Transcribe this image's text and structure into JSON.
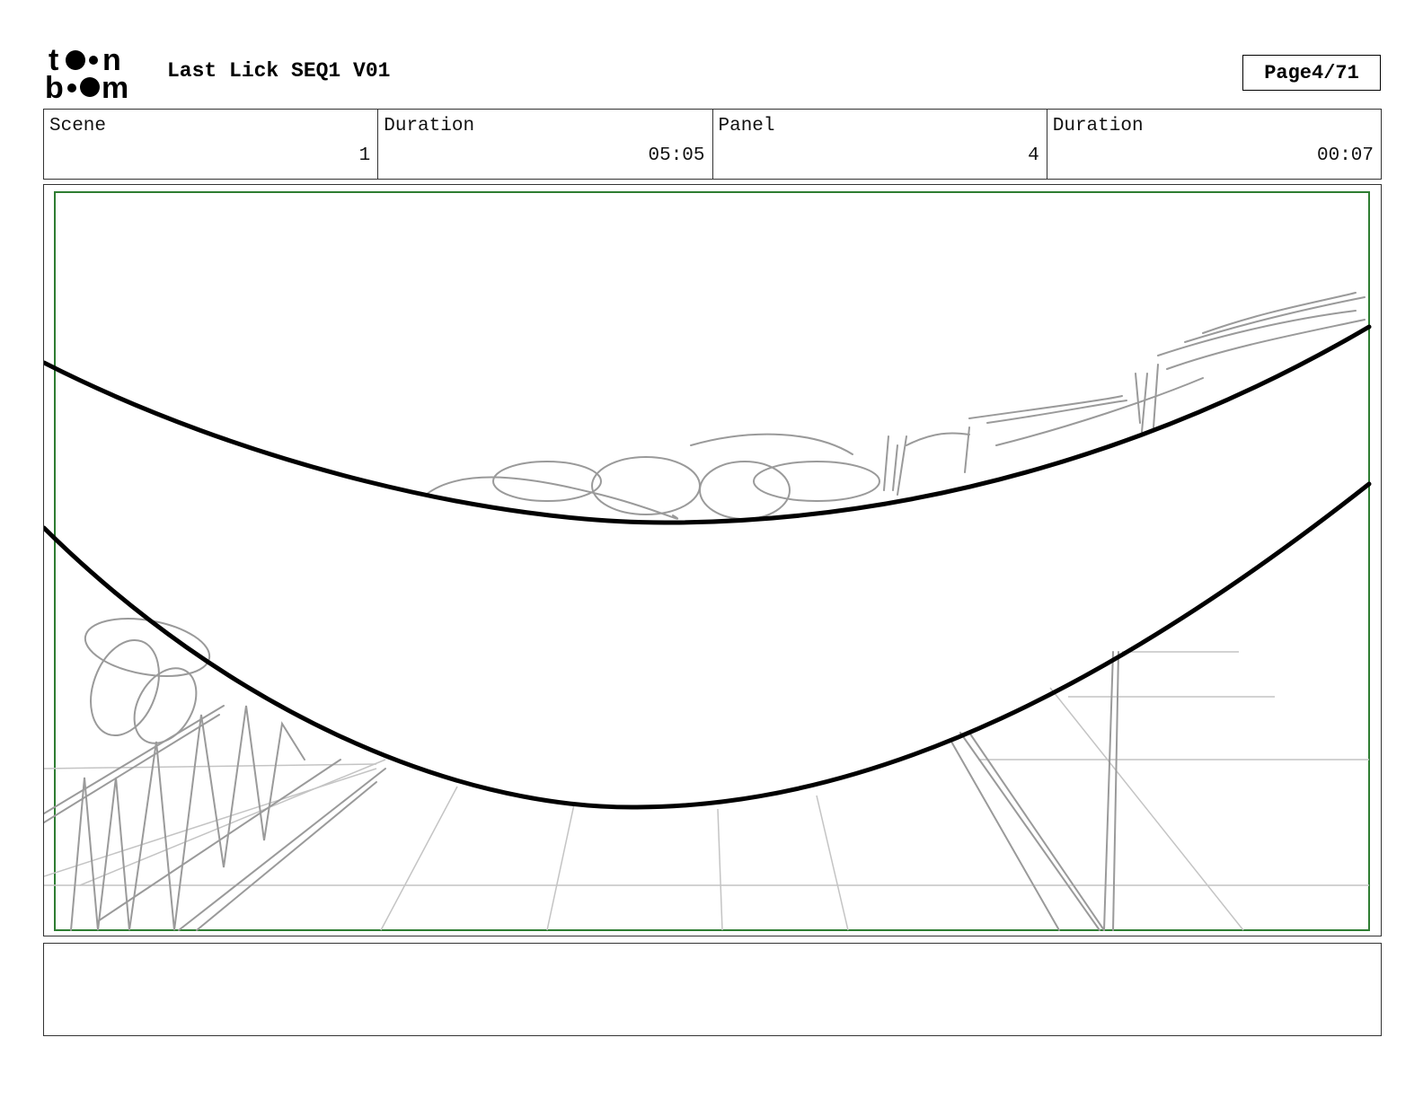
{
  "header": {
    "logo": "toon boom",
    "title": "Last Lick SEQ1 V01",
    "page_label": "Page",
    "page_value": "4/71"
  },
  "info": {
    "scene_label": "Scene",
    "scene_value": "1",
    "scene_duration_label": "Duration",
    "scene_duration_value": "05:05",
    "panel_label": "Panel",
    "panel_value": "4",
    "panel_duration_label": "Duration",
    "panel_duration_value": "00:07"
  },
  "panel": {
    "frame_color": "#2e7d32",
    "ink_color": "#000000",
    "sketch_color": "#9a9a9a"
  },
  "caption": {
    "text": ""
  }
}
